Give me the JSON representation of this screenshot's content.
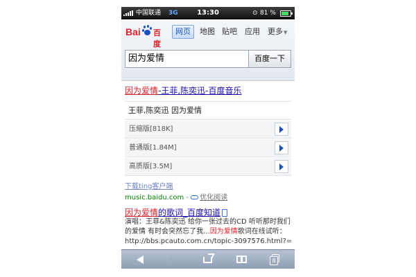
{
  "status_bar": {
    "carrier": "中国联通",
    "network": "3G",
    "time": "13:30",
    "battery_percent": "81 %",
    "battery_level": 0.81
  },
  "header": {
    "logo_text_left": "Bai",
    "logo_text_right": "百度",
    "nav": [
      {
        "label": "网页",
        "active": true
      },
      {
        "label": "地图",
        "active": false
      },
      {
        "label": "贴吧",
        "active": false
      },
      {
        "label": "应用",
        "active": false
      },
      {
        "label": "更多",
        "active": false
      }
    ],
    "search_value": "因为爱情",
    "search_button": "百度一下"
  },
  "results": {
    "r1": {
      "title_highlight": "因为爱情",
      "title_rest": "-王菲,陈奕迅-百度音乐",
      "artist_line": "王菲,陈奕迅 因为爱情",
      "versions": [
        "压缩版[818K]",
        "普通版[1.84M]",
        "高质版[3.5M]"
      ],
      "client_link": "下载ting客户端",
      "url": "music.baidu.com",
      "sep": " - ",
      "optimize": "优化阅读"
    },
    "r2": {
      "title_highlight": "因为爱情",
      "title_rest": "的歌词_百度知道",
      "snippet_a": "演唱：王菲&陈奕迅 给你一张过去的CD 听听那时我们的爱情 有时会突然忘了我...",
      "snippet_hl": "因为爱情",
      "snippet_b": "歌词在线试听： http://bbs.pcauto.com.cn/topic-3097576.html?="
    }
  },
  "toolbar": {
    "tab_count": "8"
  }
}
